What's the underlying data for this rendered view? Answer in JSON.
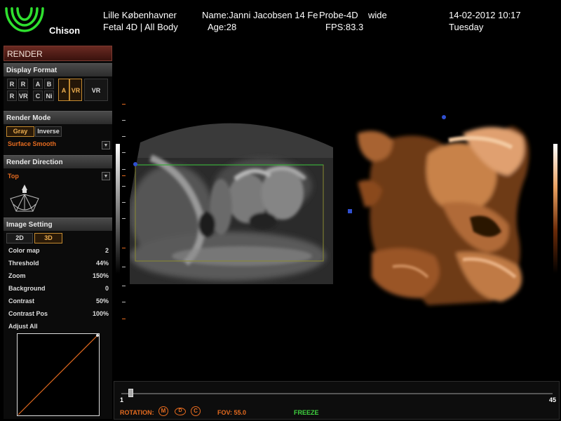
{
  "header": {
    "brand": "Chison",
    "hospital": "Lille København​er",
    "exam": "Fetal 4D | All Body",
    "patient_name": "Name:Janni Jacobsen 14 Fe",
    "age": "Age:28",
    "probe": "Probe-4D",
    "mode": "wide",
    "fps": "FPS:83.3",
    "date_time": "14-02-2012  10:17",
    "weekday": "Tuesday"
  },
  "panel": {
    "title": "RENDER",
    "display_format": {
      "title": "Display Format",
      "cells": [
        "R",
        "R",
        "A",
        "B",
        "R",
        "VR",
        "C",
        "Ni",
        "A",
        "VR",
        "VR"
      ]
    },
    "render_mode": {
      "title": "Render Mode",
      "gray": "Gray",
      "inverse": "Inverse",
      "surface": "Surface Smooth"
    },
    "render_direction": {
      "title": "Render Direction",
      "value": "Top"
    },
    "image_setting": {
      "title": "Image Setting",
      "tab_2d": "2D",
      "tab_3d": "3D",
      "rows": [
        {
          "label": "Color map",
          "value": "2"
        },
        {
          "label": "Threshold",
          "value": "44%"
        },
        {
          "label": "Zoom",
          "value": "150%"
        },
        {
          "label": "Background",
          "value": "0"
        },
        {
          "label": "Contrast",
          "value": "50%"
        },
        {
          "label": "Contrast Pos",
          "value": "100%"
        }
      ],
      "adjust_all": "Adjust All"
    }
  },
  "bottom": {
    "slider_min": "1",
    "slider_max": "45",
    "slider_value": 1,
    "rotation_label": "ROTATION:",
    "rot_m": "M",
    "rot_d": "D",
    "rot_c": "C",
    "fov": "FOV: 55.0",
    "freeze": "FREEZE"
  },
  "colors": {
    "accent_orange": "#e56b1f",
    "logo_green": "#2fe02f",
    "freeze_green": "#3fd23f",
    "roi_green": "#3aa83a"
  }
}
